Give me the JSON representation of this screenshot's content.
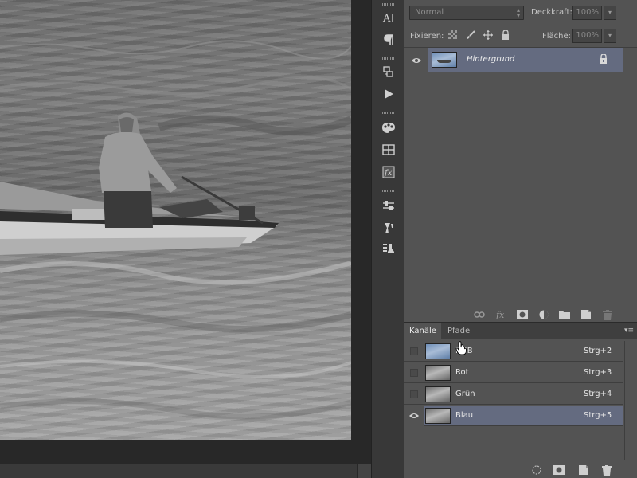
{
  "layers_panel": {
    "blend_mode": "Normal",
    "opacity_label": "Deckkraft:",
    "opacity_value": "100%",
    "lock_label": "Fixieren:",
    "fill_label": "Fläche:",
    "fill_value": "100%",
    "layers": [
      {
        "name": "Hintergrund",
        "visible": true,
        "locked": true,
        "selected": true
      }
    ]
  },
  "channels_panel": {
    "tabs": [
      {
        "label": "Kanäle",
        "active": true
      },
      {
        "label": "Pfade",
        "active": false
      }
    ],
    "channels": [
      {
        "name": "RGB",
        "shortcut": "Strg+2",
        "visible": false,
        "selected": false
      },
      {
        "name": "Rot",
        "shortcut": "Strg+3",
        "visible": false,
        "selected": false
      },
      {
        "name": "Grün",
        "shortcut": "Strg+4",
        "visible": false,
        "selected": false
      },
      {
        "name": "Blau",
        "shortcut": "Strg+5",
        "visible": true,
        "selected": true
      }
    ]
  },
  "tools_dock": {
    "icons": [
      "character-icon",
      "paragraph-icon",
      "history-icon",
      "actions-play-icon",
      "swatches-icon",
      "libraries-icon",
      "styles-fx-icon",
      "adjustments-icon",
      "tool-presets-icon",
      "clone-source-icon"
    ]
  },
  "colors": {
    "selection": "#646b80",
    "panel_bg": "#535353",
    "dock_bg": "#383838",
    "canvas_bg": "#282828"
  }
}
